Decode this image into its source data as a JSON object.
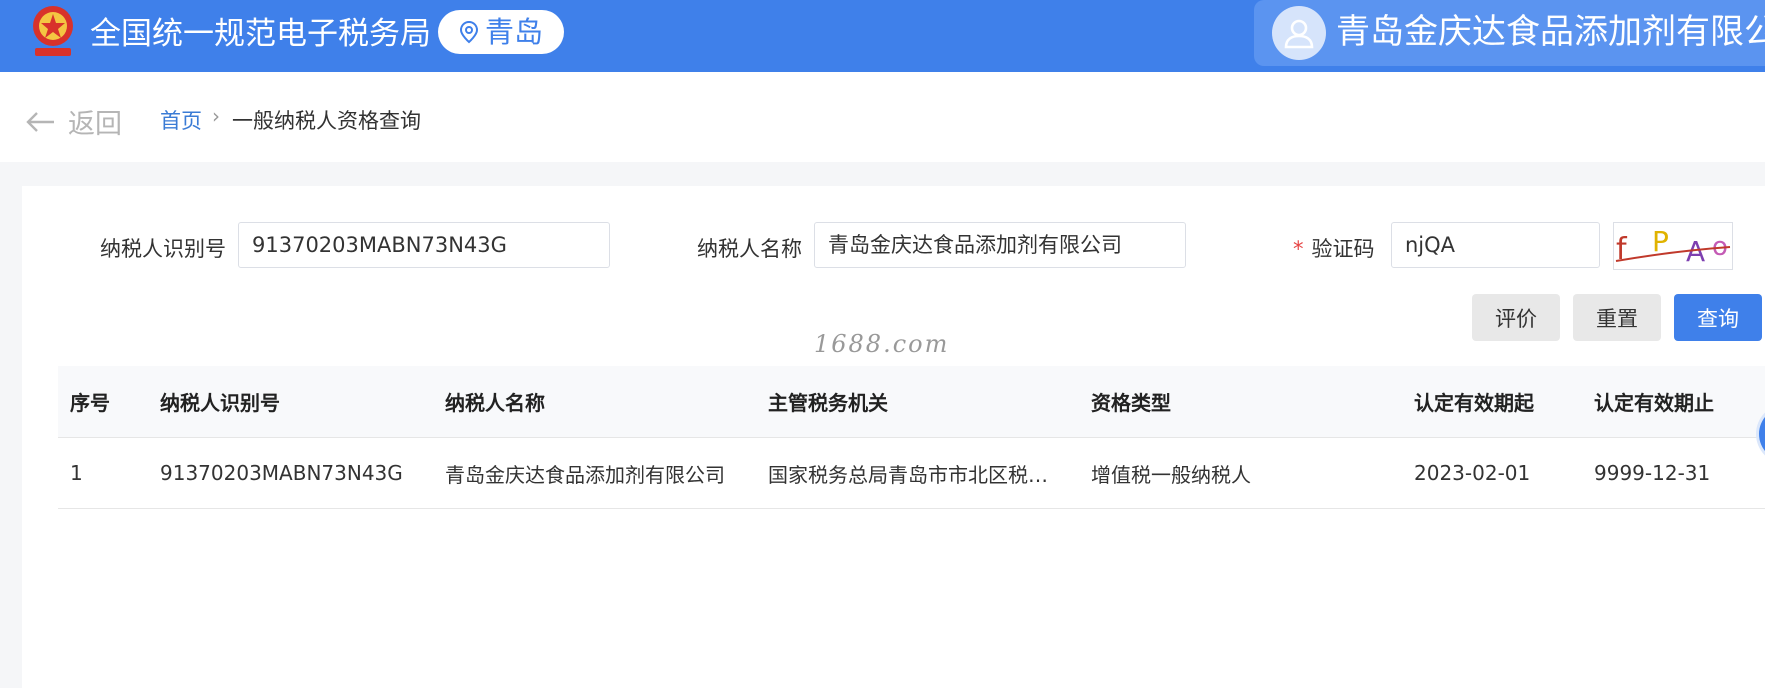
{
  "header": {
    "site_title": "全国统一规范电子税务局",
    "city": "青岛",
    "user_name": "青岛金庆达食品添加剂有限公司",
    "colors": {
      "brand": "#3f80ea",
      "user_panel": "#5b94f0"
    }
  },
  "breadcrumb": {
    "back_label": "返回",
    "home": "首页",
    "separator": "›",
    "current": "一般纳税人资格查询"
  },
  "form": {
    "taxpayer_id_label": "纳税人识别号",
    "taxpayer_id_value": "91370203MABN73N43G",
    "taxpayer_name_label": "纳税人名称",
    "taxpayer_name_value": "青岛金庆达食品添加剂有限公司",
    "required_mark": "*",
    "captcha_label": "验证码",
    "captcha_value": "njQA",
    "captcha_image_text": "fPAo"
  },
  "buttons": {
    "evaluate": "评价",
    "reset": "重置",
    "query": "查询"
  },
  "watermark": "1688.com",
  "table": {
    "columns": [
      "序号",
      "纳税人识别号",
      "纳税人名称",
      "主管税务机关",
      "资格类型",
      "认定有效期起",
      "认定有效期止"
    ],
    "rows": [
      [
        "1",
        "91370203MABN73N43G",
        "青岛金庆达食品添加剂有限公司",
        "国家税务总局青岛市市北区税…",
        "增值税一般纳税人",
        "2023-02-01",
        "9999-12-31"
      ]
    ]
  }
}
